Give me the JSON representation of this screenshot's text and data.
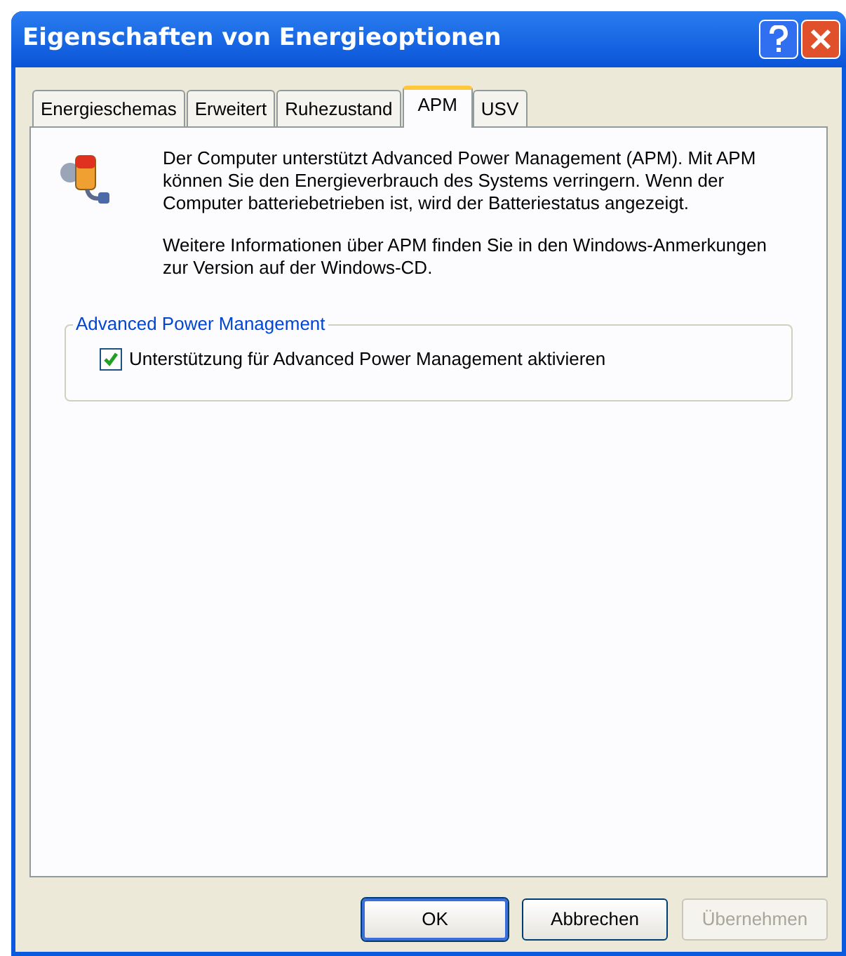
{
  "window": {
    "title": "Eigenschaften von Energieoptionen"
  },
  "tabs": [
    {
      "label": "Energieschemas",
      "selected": false
    },
    {
      "label": "Erweitert",
      "selected": false
    },
    {
      "label": "Ruhezustand",
      "selected": false
    },
    {
      "label": "APM",
      "selected": true
    },
    {
      "label": "USV",
      "selected": false
    }
  ],
  "info": [
    "Der Computer unterstützt Advanced Power Management (APM). Mit APM können Sie den Energieverbrauch des Systems verringern. Wenn der Computer batteriebetrieben ist, wird der Batteriestatus angezeigt.",
    "Weitere Informationen über APM finden Sie in den Windows-Anmerkungen zur Version auf der Windows-CD."
  ],
  "group": {
    "title": "Advanced Power Management",
    "checkbox": {
      "label": "Unterstützung für Advanced Power Management aktivieren",
      "checked": true
    }
  },
  "buttons": [
    {
      "label": "OK",
      "disabled": false,
      "default": true
    },
    {
      "label": "Abbrechen",
      "disabled": false,
      "default": false
    },
    {
      "label": "Übernehmen",
      "disabled": true,
      "default": false
    }
  ]
}
